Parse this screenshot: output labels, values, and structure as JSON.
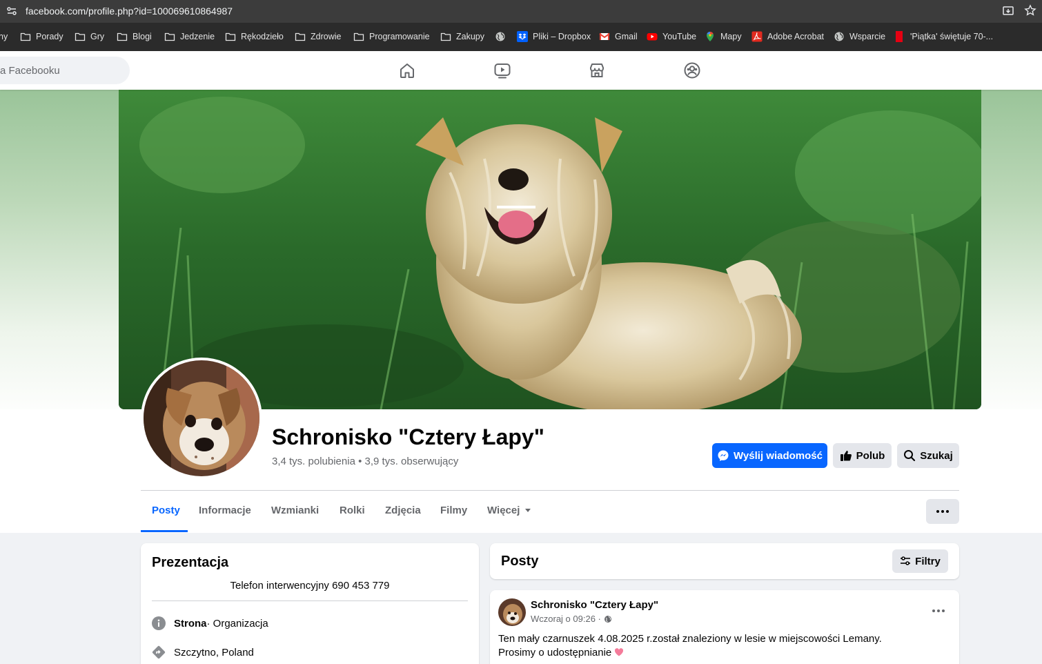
{
  "browser": {
    "url": "facebook.com/profile.php?id=100069610864987",
    "bookmarks": [
      {
        "label": "ny",
        "icon": "folder-icon"
      },
      {
        "label": "Porady",
        "icon": "folder-icon"
      },
      {
        "label": "Gry",
        "icon": "folder-icon"
      },
      {
        "label": "Blogi",
        "icon": "folder-icon"
      },
      {
        "label": "Jedzenie",
        "icon": "folder-icon"
      },
      {
        "label": "Rękodzieło",
        "icon": "folder-icon"
      },
      {
        "label": "Zdrowie",
        "icon": "folder-icon"
      },
      {
        "label": "Programowanie",
        "icon": "folder-icon"
      },
      {
        "label": "Zakupy",
        "icon": "folder-icon"
      },
      {
        "label": "",
        "icon": "globe-icon"
      },
      {
        "label": "Pliki – Dropbox",
        "icon": "dropbox-icon"
      },
      {
        "label": "Gmail",
        "icon": "gmail-icon"
      },
      {
        "label": "YouTube",
        "icon": "youtube-icon"
      },
      {
        "label": "Mapy",
        "icon": "maps-pin-icon"
      },
      {
        "label": "Adobe Acrobat",
        "icon": "acrobat-icon"
      },
      {
        "label": "Wsparcie",
        "icon": "globe-icon"
      },
      {
        "label": "'Piątka' świętuje 70-...",
        "icon": "red-bookmark-icon"
      }
    ]
  },
  "fb": {
    "search_placeholder": "a Facebooku",
    "nav_icons": [
      "home-icon",
      "video-icon",
      "marketplace-icon",
      "groups-icon"
    ],
    "colors": {
      "accent": "#0866ff",
      "text_secondary": "#65676b",
      "button_grey": "#e4e6eb",
      "page_bg": "#f0f2f5"
    }
  },
  "profile": {
    "name": "Schronisko \"Cztery Łapy\"",
    "stats": "3,4 tys. polubienia • 3,9 tys. obserwujący",
    "buttons": {
      "message": "Wyślij wiadomość",
      "like": "Polub",
      "search": "Szukaj"
    },
    "tabs": [
      "Posty",
      "Informacje",
      "Wzmianki",
      "Rolki",
      "Zdjęcia",
      "Filmy",
      "Więcej"
    ],
    "active_tab": "Posty"
  },
  "intro": {
    "title": "Prezentacja",
    "bio": "Telefon interwencyjny 690 453 779",
    "page_label": "Strona",
    "page_category": " · Organizacja",
    "location": "Szczytno, Poland"
  },
  "posts": {
    "title": "Posty",
    "filters_label": "Filtry",
    "items": [
      {
        "author": "Schronisko \"Cztery Łapy\"",
        "time": "Wczoraj o 09:26 ·",
        "line1": "Ten mały czarnuszek 4.08.2025 r.został znaleziony w lesie w miejscowości Lemany.",
        "line2": "Prosimy o udostępnianie "
      }
    ]
  }
}
